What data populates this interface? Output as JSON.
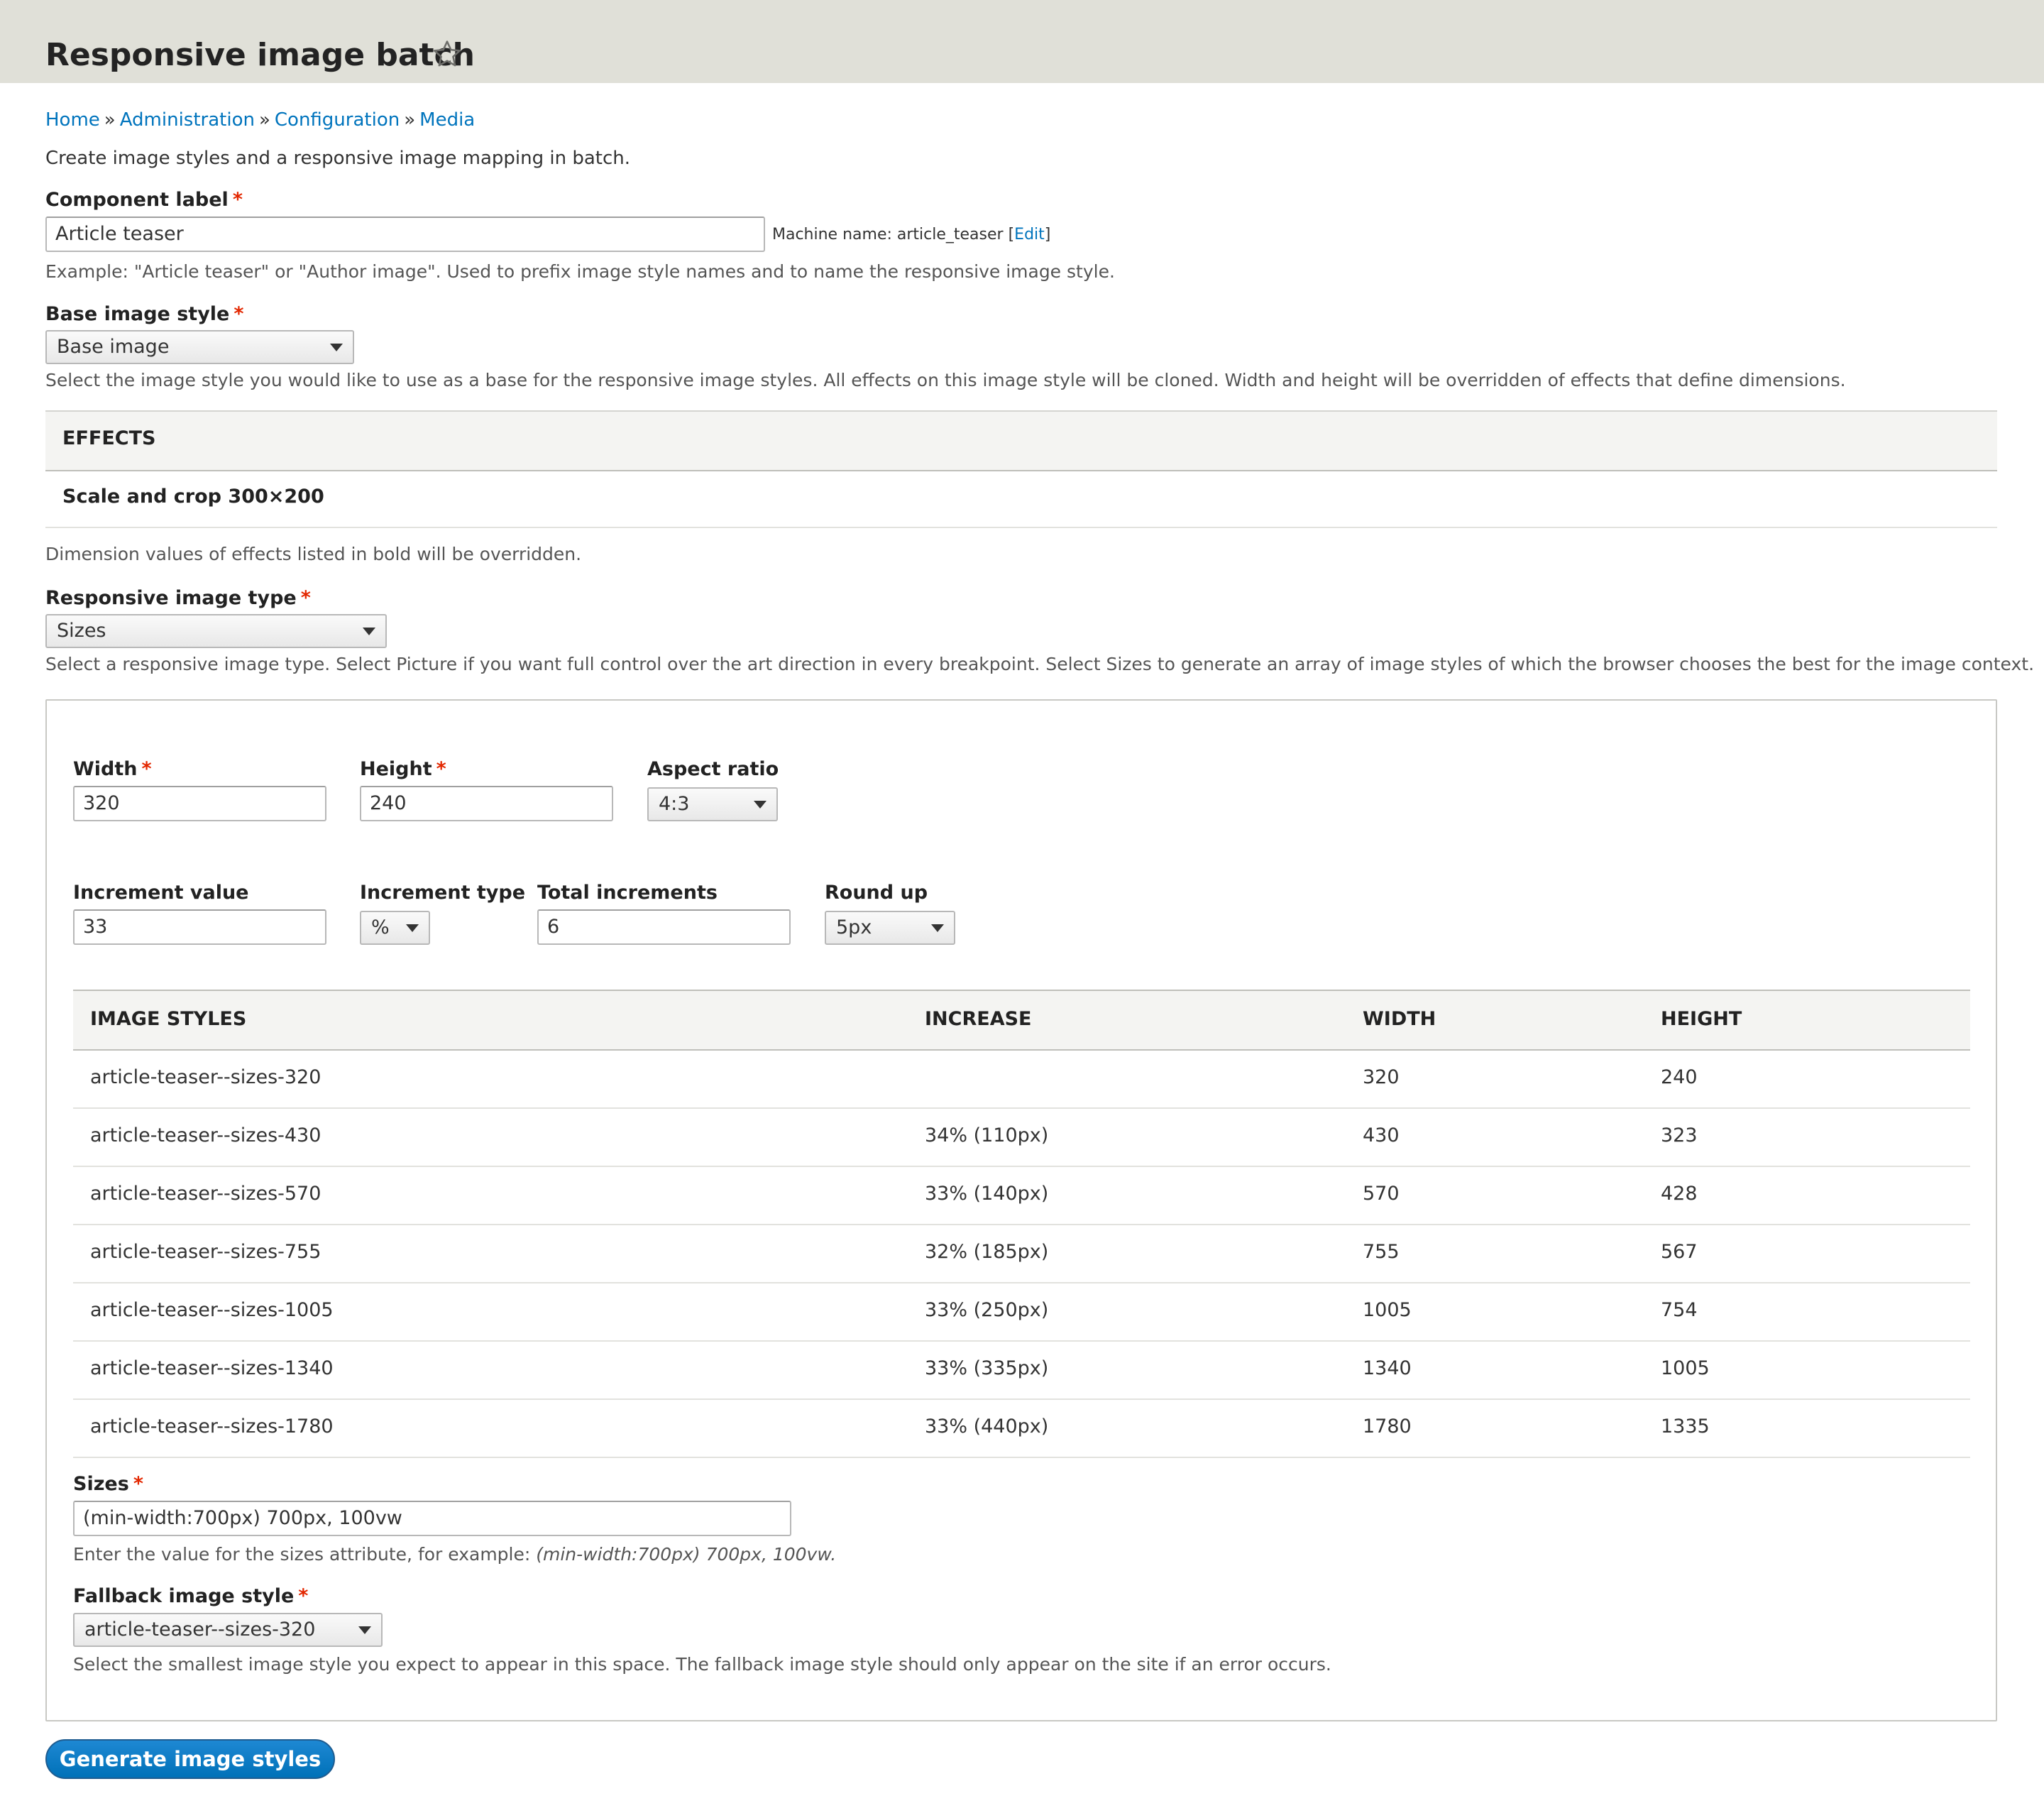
{
  "header": {
    "title": "Responsive image batch",
    "star_icon": "star-outline-icon"
  },
  "breadcrumb": [
    {
      "label": "Home"
    },
    {
      "label": "Administration"
    },
    {
      "label": "Configuration"
    },
    {
      "label": "Media"
    }
  ],
  "breadcrumb_separator": "»",
  "intro": "Create image styles and a responsive image mapping in batch.",
  "component_label": {
    "label": "Component label",
    "required_mark": "*",
    "value": "Article teaser",
    "machine_name_prefix": "Machine name: article_teaser ",
    "machine_name_open": "[",
    "machine_name_edit": "Edit",
    "machine_name_close": "]",
    "description": "Example: \"Article teaser\" or \"Author image\". Used to prefix image style names and to name the responsive image style."
  },
  "base_image_style": {
    "label": "Base image style",
    "required_mark": "*",
    "value": "Base image",
    "description": "Select the image style you would like to use as a base for the responsive image styles. All effects on this image style will be cloned. Width and height will be overridden of effects that define dimensions."
  },
  "effects": {
    "header": "EFFECTS",
    "rows": [
      "Scale and crop 300×200"
    ],
    "note": "Dimension values of effects listed in bold will be overridden."
  },
  "responsive_image_type": {
    "label": "Responsive image type",
    "required_mark": "*",
    "value": "Sizes",
    "description": "Select a responsive image type. Select Picture if you want full control over the art direction in every breakpoint. Select Sizes to generate an array of image styles of which the browser chooses the best for the image context."
  },
  "dimensions": {
    "width": {
      "label": "Width",
      "required_mark": "*",
      "value": "320"
    },
    "height": {
      "label": "Height",
      "required_mark": "*",
      "value": "240"
    },
    "aspect_ratio": {
      "label": "Aspect ratio",
      "value": "4:3"
    }
  },
  "increments": {
    "increment_value": {
      "label": "Increment value",
      "value": "33"
    },
    "increment_type": {
      "label": "Increment type",
      "value": "%"
    },
    "total_increments": {
      "label": "Total increments",
      "value": "6"
    },
    "round_up": {
      "label": "Round up",
      "value": "5px"
    }
  },
  "styles_table": {
    "headers": [
      "IMAGE STYLES",
      "INCREASE",
      "WIDTH",
      "HEIGHT"
    ],
    "rows": [
      [
        "article-teaser--sizes-320",
        "",
        "320",
        "240"
      ],
      [
        "article-teaser--sizes-430",
        "34% (110px)",
        "430",
        "323"
      ],
      [
        "article-teaser--sizes-570",
        "33% (140px)",
        "570",
        "428"
      ],
      [
        "article-teaser--sizes-755",
        "32% (185px)",
        "755",
        "567"
      ],
      [
        "article-teaser--sizes-1005",
        "33% (250px)",
        "1005",
        "754"
      ],
      [
        "article-teaser--sizes-1340",
        "33% (335px)",
        "1340",
        "1005"
      ],
      [
        "article-teaser--sizes-1780",
        "33% (440px)",
        "1780",
        "1335"
      ]
    ]
  },
  "sizes": {
    "label": "Sizes",
    "required_mark": "*",
    "value": "(min-width:700px) 700px, 100vw",
    "description_prefix": "Enter the value for the sizes attribute, for example: ",
    "description_example": "(min-width:700px) 700px, 100vw."
  },
  "fallback": {
    "label": "Fallback image style",
    "required_mark": "*",
    "value": "article-teaser--sizes-320",
    "description": "Select the smallest image style you expect to appear in this space. The fallback image style should only appear on the site if an error occurs."
  },
  "submit_label": "Generate image styles",
  "colors": {
    "header_bg": "#e0e0d8",
    "link": "#0074bd",
    "required": "#e32700",
    "primary_button": "#0071b8"
  }
}
